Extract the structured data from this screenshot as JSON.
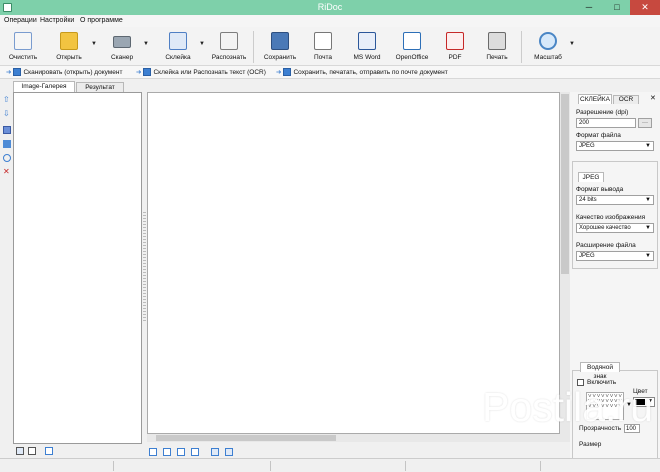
{
  "window": {
    "title": "RiDoc",
    "minimize": "─",
    "maximize": "□",
    "close": "✕"
  },
  "menu": [
    "Операции",
    "Настройки",
    "О программе"
  ],
  "toolbar": {
    "clear": "Очистить",
    "open": "Открыть",
    "scanner": "Сканер",
    "glue": "Склейка",
    "recognize": "Распознать",
    "save": "Сохранить",
    "mail": "Почта",
    "msword": "MS Word",
    "openoffice": "OpenOffice",
    "pdf": "PDF",
    "print": "Печать",
    "zoom": "Масштаб"
  },
  "actions": [
    "Сканировать (открыть) документ",
    "Склейка или Распознать текст (OCR)",
    "Сохранить, печатать, отправить по почте документ"
  ],
  "left_tabs": {
    "gallery": "Image-Галерея",
    "result": "Результат"
  },
  "right_panel": {
    "tabs": {
      "glue": "СКЛЕЙКА",
      "ocr": "OCR"
    },
    "close": "✕",
    "resolution_label": "Разрешение (dpi)",
    "resolution_value": "200",
    "resolution_btn": "···",
    "file_format_label": "Формат файла",
    "file_format_value": "JPEG",
    "sub_tab": "JPEG",
    "output_format_label": "Формат вывода",
    "output_format_value": "24 bits",
    "image_quality_label": "Качество изображения",
    "image_quality_value": "Хорошее качество",
    "file_ext_label": "Расширение файла",
    "file_ext_value": "JPEG",
    "watermark_title": "Водяной знак",
    "watermark_enable": "Включить",
    "watermark_sample": "V V V V V V V V V V V V V V V V V V V V V V V V",
    "watermark_color_label": "Цвет",
    "watermark_transparency": "Прозрачность",
    "watermark_transparency_value": "100",
    "watermark_size": "Размер"
  },
  "watermark_text": "Postila.ru",
  "colors": {
    "titlebar": "#7ed0aa",
    "close": "#c7493f",
    "accent": "#3d7fd1"
  }
}
